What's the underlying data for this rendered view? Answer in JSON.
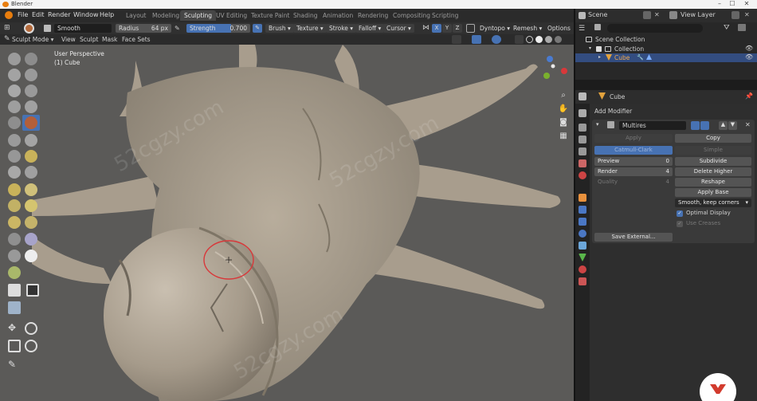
{
  "window": {
    "title": "Blender",
    "controls": [
      "–",
      "☐",
      "✕"
    ]
  },
  "menu": {
    "items": [
      "File",
      "Edit",
      "Render",
      "Window",
      "Help"
    ],
    "workspaces": [
      "Layout",
      "Modeling",
      "Sculpting",
      "UV Editing",
      "Texture Paint",
      "Shading",
      "Animation",
      "Rendering",
      "Compositing",
      "Scripting"
    ],
    "active_workspace": "Sculpting",
    "scene_label": "Scene",
    "view_layer_label": "View Layer"
  },
  "tool_header": {
    "brush_name": "Smooth",
    "radius_label": "Radius",
    "radius_value": "64 px",
    "strength_label": "Strength",
    "strength_value": "0.700",
    "dropdowns": [
      "Brush",
      "Texture",
      "Stroke",
      "Falloff",
      "Cursor"
    ],
    "axes": [
      "X",
      "Y",
      "Z"
    ],
    "dyntopo": "Dyntopo",
    "remesh": "Remesh",
    "options": "Options"
  },
  "mode_header": {
    "mode": "Sculpt Mode",
    "menus": [
      "View",
      "Sculpt",
      "Mask",
      "Face Sets"
    ]
  },
  "viewport": {
    "perspective": "User Perspective",
    "object": "(1) Cube",
    "colors": {
      "background": "#5b5a58",
      "mesh": "#a79c8c",
      "brush_circle": "#d8383a"
    }
  },
  "outliner": {
    "search_placeholder": "",
    "rows": [
      {
        "label": "Scene Collection"
      },
      {
        "label": "Collection"
      },
      {
        "label": "Cube"
      }
    ]
  },
  "properties": {
    "object_name": "Cube",
    "add_modifier": "Add Modifier",
    "modifier_name": "Multires",
    "apply": "Apply",
    "copy": "Copy",
    "catmull_clark": "Catmull-Clark",
    "simple": "Simple",
    "preview_label": "Preview",
    "preview_value": "0",
    "render_label": "Render",
    "render_value": "4",
    "quality_label": "Quality",
    "quality_value": "4",
    "subdivide": "Subdivide",
    "delete_higher": "Delete Higher",
    "reshape": "Reshape",
    "apply_base": "Apply Base",
    "uv_smooth": "Smooth, keep corners",
    "optimal_display": "Optimal Display",
    "use_creases": "Use Creases",
    "save_external": "Save External..."
  },
  "watermark": "52cgzy.com"
}
